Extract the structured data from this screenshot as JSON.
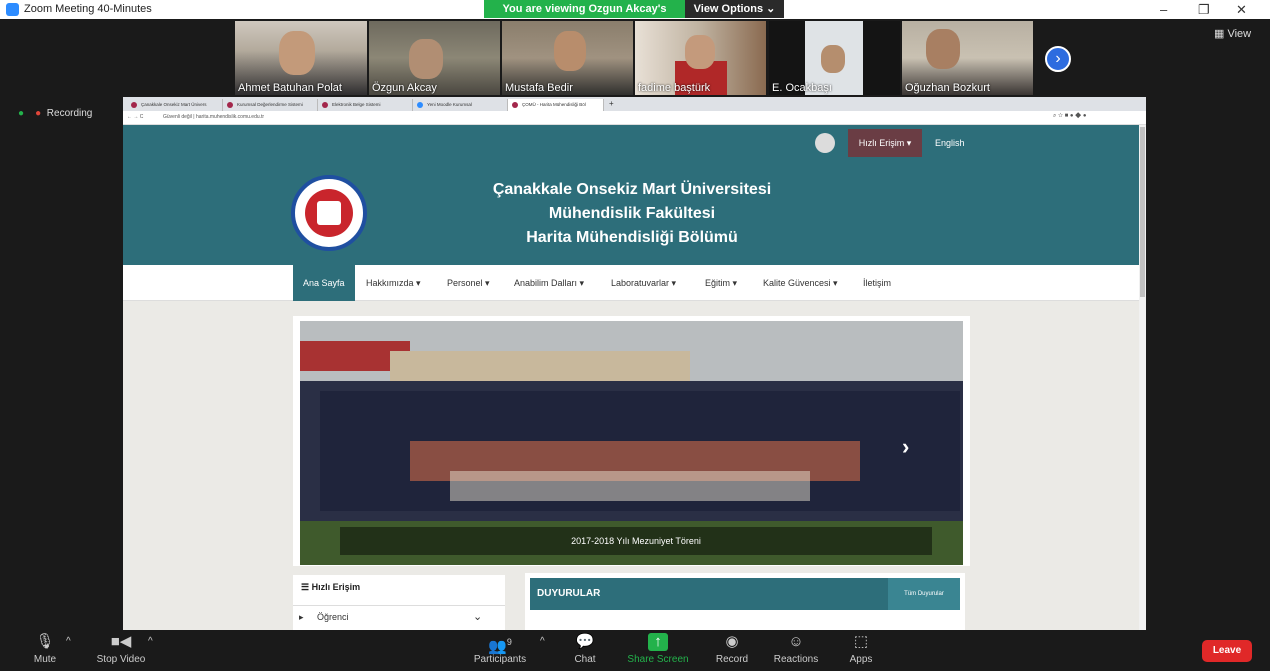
{
  "window": {
    "title": "Zoom Meeting 40-Minutes"
  },
  "share_banner": {
    "viewing": "You are viewing Ozgun Akcay's screen",
    "view_options": "View Options ⌄"
  },
  "view_button": "View",
  "recording": "Recording",
  "participants_strip": [
    {
      "name": "Ahmet Batuhan Polat"
    },
    {
      "name": "Özgun Akcay"
    },
    {
      "name": "Mustafa Bedir"
    },
    {
      "name": "fadime baştürk"
    },
    {
      "name": "E. Ocakbaşı"
    },
    {
      "name": "Oğuzhan Bozkurt"
    }
  ],
  "browser": {
    "tabs": [
      "Çanakkale Onsekiz Mart Ünivers",
      "Kurumsal Değerlendirme Sistemi",
      "Elektronik Belge Sistemi",
      "Yeni Moodle Kurumsal",
      "ÇOMÜ - Harita Mühendisliği Böl"
    ],
    "url": "Güvenli değil | harita.muhendislik.comu.edu.tr",
    "site": {
      "quick_access": "Hızlı Erişim ▾",
      "english": "English",
      "title_lines": [
        "Çanakkale Onsekiz Mart Üniversitesi",
        "Mühendislik Fakültesi",
        "Harita Mühendisliği Bölümü"
      ],
      "menu": [
        "Ana Sayfa",
        "Hakkımızda ▾",
        "Personel ▾",
        "Anabilim Dalları ▾",
        "Laboratuvarlar ▾",
        "Eğitim ▾",
        "Kalite Güvencesi ▾",
        "İletişim"
      ],
      "slider_caption": "2017-2018 Yılı Mezuniyet Töreni",
      "sidebar_title": "Hızlı Erişim",
      "sidebar_item": "Öğrenci",
      "announcements_title": "DUYURULAR",
      "all_announcements": "Tüm Duyurular"
    }
  },
  "toolbar": {
    "mute": "Mute",
    "stop_video": "Stop Video",
    "participants": "Participants",
    "participants_count": "9",
    "chat": "Chat",
    "share_screen": "Share Screen",
    "record": "Record",
    "reactions": "Reactions",
    "apps": "Apps",
    "leave": "Leave"
  },
  "colors": {
    "teal": "#2d6e7a",
    "zoom_green": "#23b24b",
    "leave_red": "#e02828"
  }
}
